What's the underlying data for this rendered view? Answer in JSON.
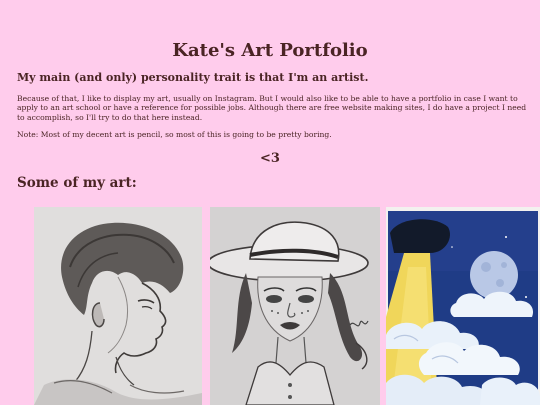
{
  "page": {
    "title": "Kate's Art Portfolio",
    "intro_heading": "My main (and only) personality trait is that I'm an artist.",
    "paragraph1": "Because of that, I like to display my art, usually on Instagram. But I would also like to be able to have a portfolio in case I want to apply to an art school or have a reference for possible jobs. Although there are free website making sites, I do have a project I need to accomplish, so I'll try to do that here instead.",
    "paragraph2": "Note: Most of my decent art is pencil, so most of this is going to be pretty boring.",
    "heart": "<3",
    "art_heading": "Some of my art:"
  },
  "gallery": [
    {
      "name": "pencil-portrait-profile",
      "medium": "pencil"
    },
    {
      "name": "pencil-portrait-hat",
      "medium": "pencil"
    },
    {
      "name": "painting-night-sky-moon",
      "medium": "paint"
    }
  ],
  "colors": {
    "background": "#ffccec",
    "text": "#4a2424"
  }
}
